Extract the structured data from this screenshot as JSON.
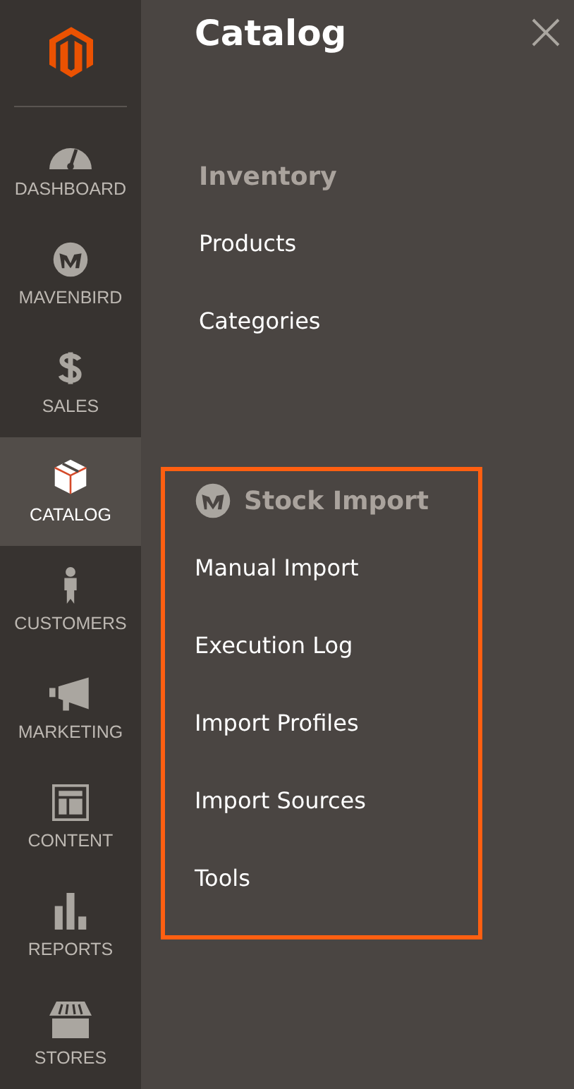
{
  "sidebar": {
    "items": [
      {
        "label": "DASHBOARD",
        "kind": "gauge",
        "selected": false
      },
      {
        "label": "MAVENBIRD",
        "kind": "brand",
        "selected": false
      },
      {
        "label": "SALES",
        "kind": "dollar",
        "selected": false
      },
      {
        "label": "CATALOG",
        "kind": "box",
        "selected": true
      },
      {
        "label": "CUSTOMERS",
        "kind": "person",
        "selected": false
      },
      {
        "label": "MARKETING",
        "kind": "megaphone",
        "selected": false
      },
      {
        "label": "CONTENT",
        "kind": "layout",
        "selected": false
      },
      {
        "label": "REPORTS",
        "kind": "bars",
        "selected": false
      },
      {
        "label": "STORES",
        "kind": "store",
        "selected": false
      }
    ]
  },
  "panel": {
    "title": "Catalog",
    "sections": [
      {
        "title": "Inventory",
        "kind": "plain",
        "highlighted": false,
        "items": [
          "Products",
          "Categories"
        ]
      },
      {
        "title": "Stock Import",
        "kind": "brand",
        "highlighted": true,
        "items": [
          "Manual Import",
          "Execution Log",
          "Import Profiles",
          "Import Sources",
          "Tools"
        ]
      }
    ]
  }
}
